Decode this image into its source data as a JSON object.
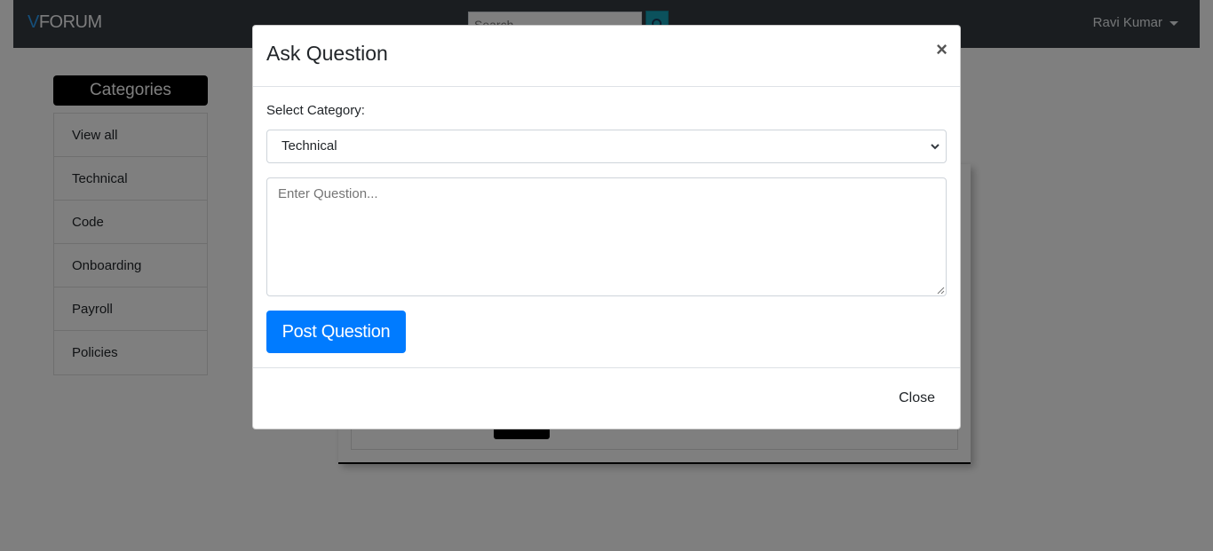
{
  "navbar": {
    "brand_v": "V",
    "brand_rest": "FORUM",
    "search_placeholder": "Search",
    "user_name": "Ravi Kumar"
  },
  "sidebar": {
    "title": "Categories",
    "items": [
      {
        "label": "View all"
      },
      {
        "label": "Technical"
      },
      {
        "label": "Code"
      },
      {
        "label": "Onboarding"
      },
      {
        "label": "Payroll"
      },
      {
        "label": "Policies"
      }
    ]
  },
  "modal": {
    "title": "Ask Question",
    "close_symbol": "×",
    "category_label": "Select Category:",
    "selected_category": "Technical",
    "question_placeholder": "Enter Question...",
    "post_button": "Post Question",
    "footer_close": "Close"
  },
  "colors": {
    "navbar_bg": "#343a40",
    "brand_accent": "#2b9df4",
    "primary_button": "#007bff",
    "search_button": "#17a2b8"
  }
}
